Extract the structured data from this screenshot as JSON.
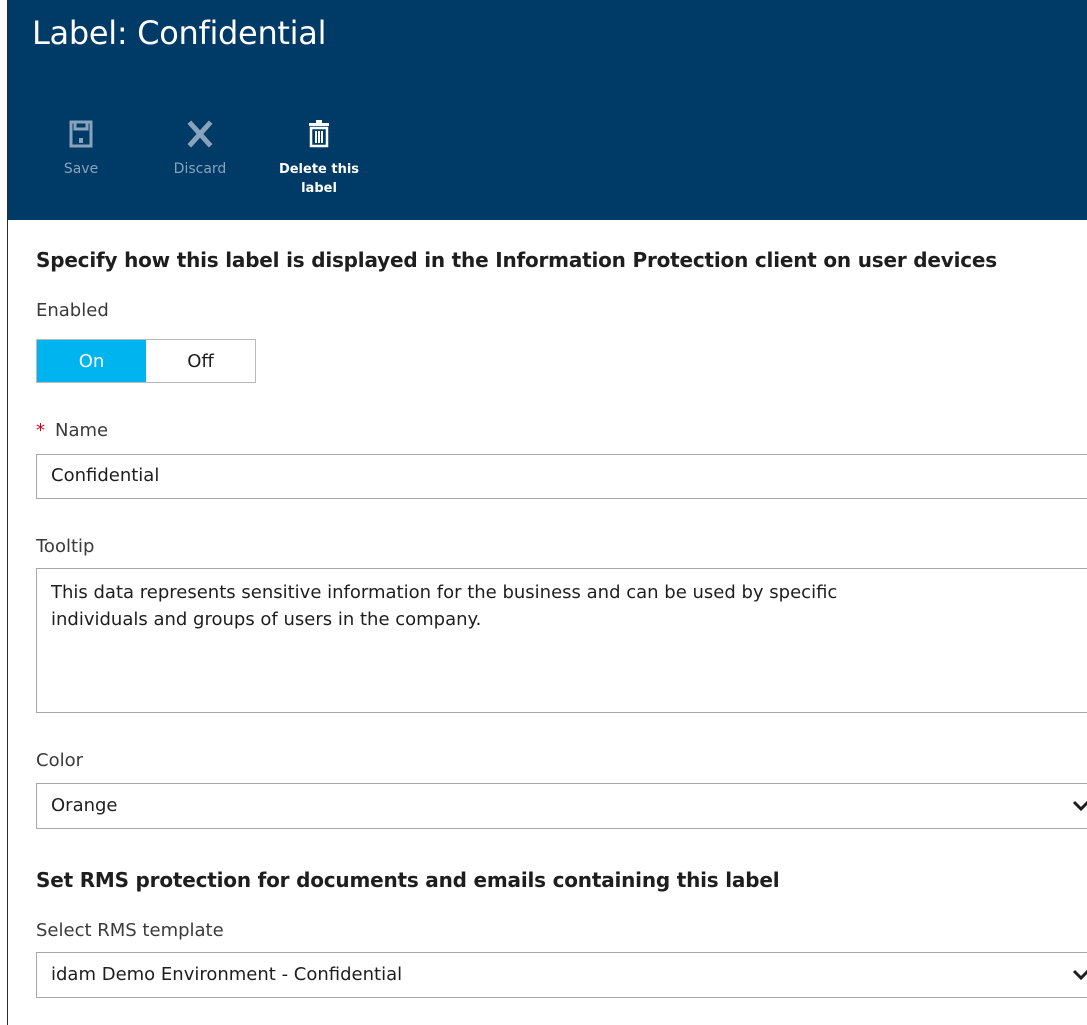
{
  "header": {
    "title": "Label: Confidential",
    "commands": {
      "save": "Save",
      "discard": "Discard",
      "delete_line1": "Delete this",
      "delete_line2": "label"
    }
  },
  "display_section": {
    "heading": "Specify how this label is displayed in the Information Protection client on user devices",
    "enabled": {
      "label": "Enabled",
      "on": "On",
      "off": "Off",
      "selected": "On"
    },
    "name": {
      "required_marker": "*",
      "label": "Name",
      "value": "Confidential"
    },
    "tooltip": {
      "label": "Tooltip",
      "value": "This data represents sensitive information for the business and can be used by specific\nindividuals and groups of users in the company."
    },
    "color": {
      "label": "Color",
      "value": "Orange"
    }
  },
  "rms_section": {
    "heading": "Set RMS protection for documents and emails containing this label",
    "template": {
      "label": "Select RMS template",
      "value": "idam Demo Environment - Confidential"
    }
  },
  "colors": {
    "header_bg": "#003a66",
    "toggle_on": "#00b4ef",
    "required": "#d0021b",
    "disabled_text": "#8aa3bc"
  },
  "icons": [
    "save-icon",
    "discard-icon",
    "delete-icon",
    "chevron-down-icon"
  ]
}
